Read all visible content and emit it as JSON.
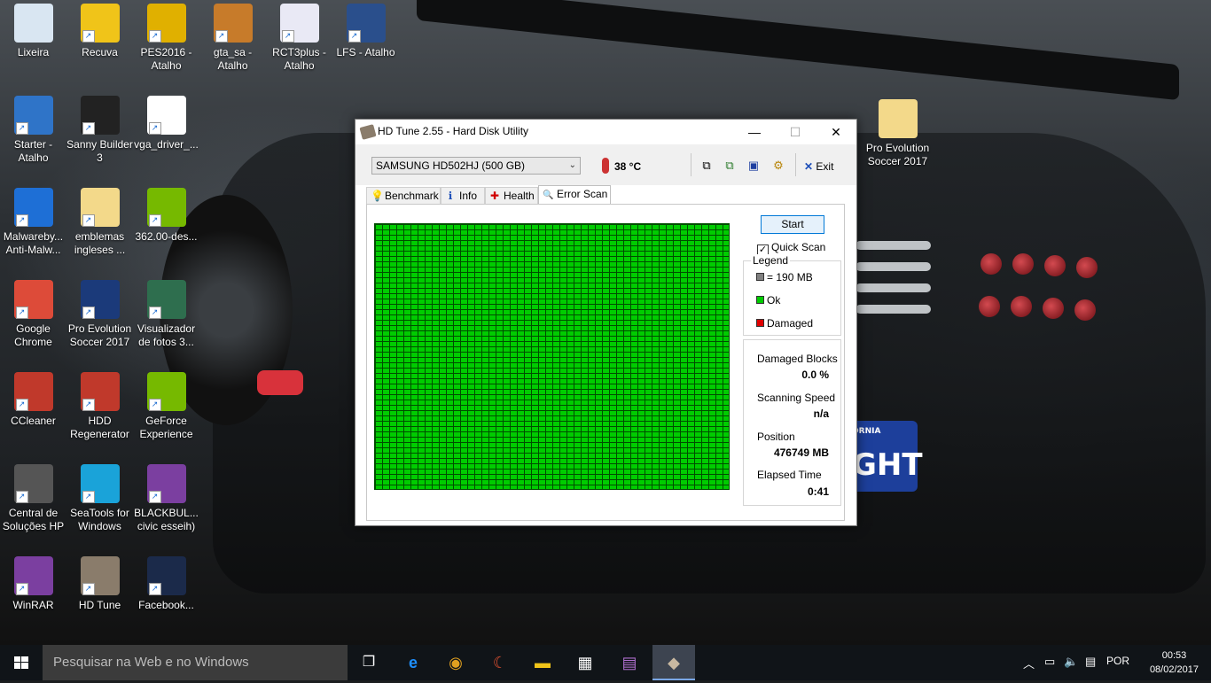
{
  "desktop": {
    "icons": [
      {
        "label": "Lixeira",
        "color": "#d9e6f2"
      },
      {
        "label": "Recuva",
        "color": "#f0c419"
      },
      {
        "label": "PES2016 - Atalho",
        "color": "#e0b000"
      },
      {
        "label": "gta_sa - Atalho",
        "color": "#c77b2a"
      },
      {
        "label": "RCT3plus - Atalho",
        "color": "#e9e9f5"
      },
      {
        "label": "LFS - Atalho",
        "color": "#2a4f8c"
      },
      {
        "label": "Starter - Atalho",
        "color": "#2f74c8"
      },
      {
        "label": "Sanny Builder 3",
        "color": "#222222"
      },
      {
        "label": "vga_driver_...",
        "color": "#ffffff"
      },
      {
        "label": "Malwareby... Anti-Malw...",
        "color": "#1e6fd6"
      },
      {
        "label": "emblemas ingleses ...",
        "color": "#f3d98a"
      },
      {
        "label": "362.00-des...",
        "color": "#76b900"
      },
      {
        "label": "Google Chrome",
        "color": "#dd4b39"
      },
      {
        "label": "Pro Evolution Soccer 2017",
        "color": "#1b3a7a"
      },
      {
        "label": "Visualizador de fotos 3...",
        "color": "#2e6e4e"
      },
      {
        "label": "CCleaner",
        "color": "#c0392b"
      },
      {
        "label": "HDD Regenerator",
        "color": "#c0392b"
      },
      {
        "label": "GeForce Experience",
        "color": "#76b900"
      },
      {
        "label": "Central de Soluções HP",
        "color": "#555555"
      },
      {
        "label": "SeaTools for Windows",
        "color": "#1aa3d9"
      },
      {
        "label": "BLACKBUL... civic esseih)",
        "color": "#7b3fa0"
      },
      {
        "label": "WinRAR",
        "color": "#7b3fa0"
      },
      {
        "label": "HD Tune",
        "color": "#8a7c6b"
      },
      {
        "label": "Facebook...",
        "color": "#1b2a4a"
      },
      {
        "label": "Pro Evolution Soccer 2017",
        "color": "#f3d98a"
      }
    ],
    "plate_text": "GHT",
    "plate_top": "ORNIA"
  },
  "window": {
    "title": "HD Tune 2.55 - Hard Disk Utility",
    "controls": {
      "minimize": "—",
      "maximize": "☐",
      "close": "✕"
    },
    "toolbar": {
      "drive": "SAMSUNG HD502HJ (500 GB)",
      "temperature": "38 °C",
      "exit_label": "Exit"
    },
    "tabs": [
      {
        "label": "Benchmark",
        "icon": "💡"
      },
      {
        "label": "Info",
        "icon": "ℹ"
      },
      {
        "label": "Health",
        "icon": "✚"
      },
      {
        "label": "Error Scan",
        "icon": "🔍"
      }
    ],
    "error_scan": {
      "start_label": "Start",
      "quick_scan_label": "Quick Scan",
      "quick_scan_checked": true,
      "legend_title": "Legend",
      "legend": [
        {
          "label": "= 190 MB",
          "color": "#808080"
        },
        {
          "label": "Ok",
          "color": "#00cc00"
        },
        {
          "label": "Damaged",
          "color": "#e00000"
        }
      ],
      "damaged_blocks_label": "Damaged Blocks",
      "damaged_blocks_value": "0.0 %",
      "scanning_speed_label": "Scanning Speed",
      "scanning_speed_value": "n/a",
      "position_label": "Position",
      "position_value": "476749 MB",
      "elapsed_label": "Elapsed Time",
      "elapsed_value": "0:41",
      "grid_color": "#00cc00"
    }
  },
  "taskbar": {
    "search_placeholder": "Pesquisar na Web e no Windows",
    "language": "POR",
    "time": "00:53",
    "date": "08/02/2017"
  }
}
